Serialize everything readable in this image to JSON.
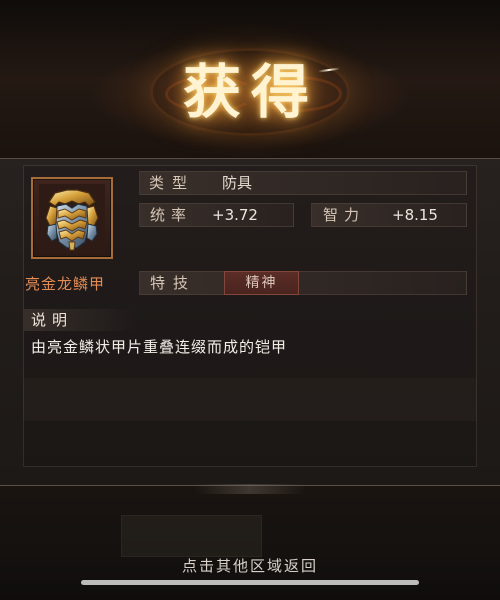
{
  "title": {
    "text": "获得"
  },
  "item": {
    "name": "亮金龙鳞甲",
    "icon": "armor-icon"
  },
  "details": {
    "type_label": "类型",
    "type_value": "防具",
    "stats": [
      {
        "label": "统率",
        "value": "+3.72"
      },
      {
        "label": "智力",
        "value": "+8.15"
      }
    ],
    "skill_label": "特技",
    "skill_value": "精神"
  },
  "description": {
    "label": "说明",
    "text": "由亮金鳞状甲片重叠连缀而成的铠甲"
  },
  "footer": {
    "hint": "点击其他区域返回"
  },
  "colors": {
    "title_glow": "#ffb846",
    "item_name": "#e18b55",
    "skill_tag": "#5b2d26"
  }
}
